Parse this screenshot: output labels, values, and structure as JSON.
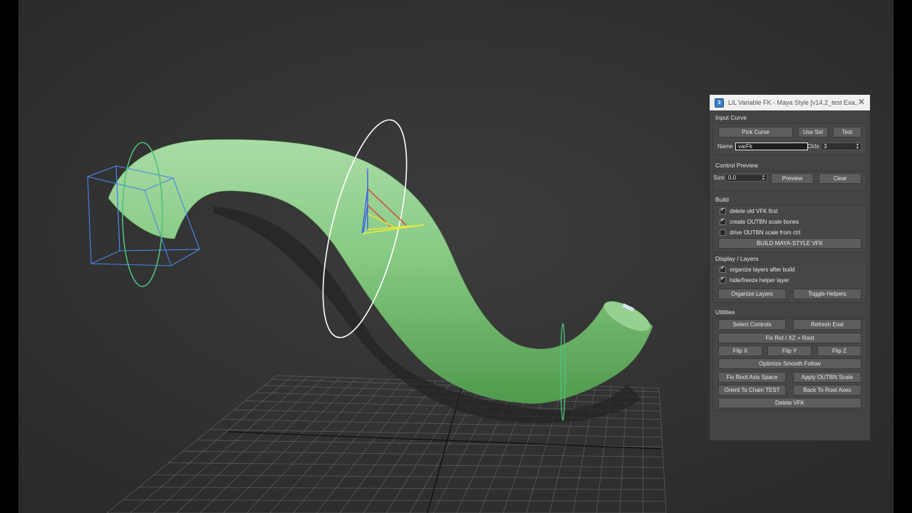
{
  "window": {
    "title": "LiL Variable FK - Maya Style [v14.2_test Exa...",
    "close_glyph": "✕"
  },
  "input_curve": {
    "header": "Input Curve",
    "pick_curve": "Pick Curve",
    "use_sel": "Use Sel",
    "test": "Test",
    "name_label": "Name",
    "name_value": "varFk",
    "ctrls_label": "Ctrls",
    "ctrls_value": "3"
  },
  "control_preview": {
    "header": "Control Preview",
    "size_label": "Size",
    "size_value": "0.0",
    "preview": "Preview",
    "clear": "Clear"
  },
  "build": {
    "header": "Build",
    "options": [
      {
        "label": "delete old VFK first",
        "checked": true
      },
      {
        "label": "create OUTBN scale bones",
        "checked": true
      },
      {
        "label": "drive OUTBN scale from ctrl",
        "checked": false
      }
    ],
    "build_button": "BUILD MAYA-STYLE VFK"
  },
  "display_layers": {
    "header": "Display / Layers",
    "options": [
      {
        "label": "organize layers after build",
        "checked": true
      },
      {
        "label": "hide/freeze helper layer",
        "checked": true
      }
    ],
    "organize": "Organize Layers",
    "toggle": "Toggle Helpers"
  },
  "utilities": {
    "header": "Utilities",
    "select_controls": "Select Controls",
    "refresh_eval": "Refresh Eval",
    "fix_rot": "Fix Rot / XZ + Root",
    "flip_x": "Flip X",
    "flip_y": "Flip Y",
    "flip_z": "Flip Z",
    "optimize": "Optimize Smooth Follow",
    "fix_root_axis": "Fix Root Axis Space",
    "apply_outbn": "Apply OUTBN Scale",
    "orient_chain": "Orient To Chain TEST",
    "back_root": "Back To Root Axes",
    "delete_vfk": "Delete VFK"
  },
  "viewport": {
    "gizmo_axis_x": "x",
    "gizmo_axis_z": "z",
    "colors": {
      "background": "#373737",
      "mesh": "#7ec87a",
      "control_ring": "#4fc27a",
      "selected_ring": "#ffffff",
      "bbox": "#4a86e8",
      "axis_x": "#e03c2e",
      "axis_y": "#e8e83a",
      "axis_z": "#3a5ae8"
    }
  }
}
